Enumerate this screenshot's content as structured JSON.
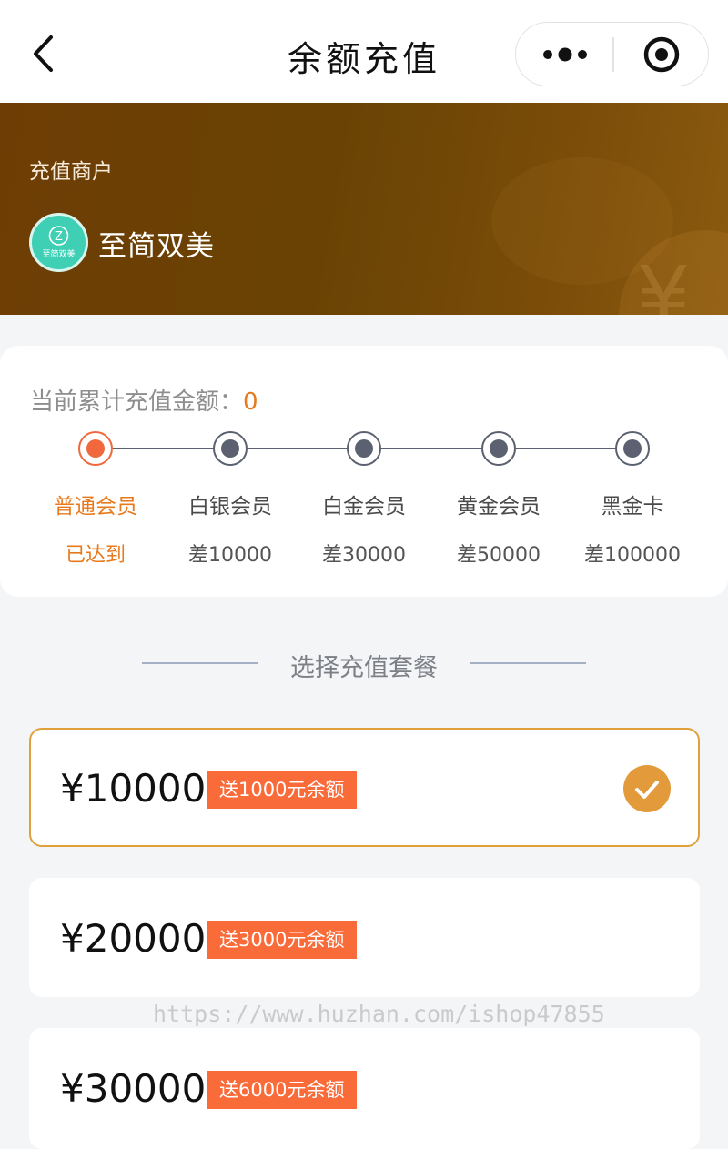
{
  "navbar": {
    "title": "余额充值",
    "back_icon": "chevron-left-icon",
    "more_icon": "more-dots-icon",
    "close_icon": "target-circle-icon"
  },
  "merchant": {
    "label": "充值商户",
    "name": "至简双美",
    "logo_icon": "merchant-logo-icon",
    "logo_text": "至简双美",
    "logo_letter": "Z",
    "banner_symbol": "¥"
  },
  "membership": {
    "cumulative_label": "当前累计充值金额：",
    "cumulative_value": "0",
    "levels": [
      {
        "name": "普通会员",
        "status": "已达到",
        "reached": true
      },
      {
        "name": "白银会员",
        "status": "差10000",
        "reached": false
      },
      {
        "name": "白金会员",
        "status": "差30000",
        "reached": false
      },
      {
        "name": "黄金会员",
        "status": "差50000",
        "reached": false
      },
      {
        "name": "黑金卡",
        "status": "差100000",
        "reached": false
      }
    ]
  },
  "plans_section": {
    "title": "选择充值套餐"
  },
  "plans": [
    {
      "price": "¥10000",
      "bonus": "送1000元余额",
      "selected": true
    },
    {
      "price": "¥20000",
      "bonus": "送3000元余额",
      "selected": false
    },
    {
      "price": "¥30000",
      "bonus": "送6000元余额",
      "selected": false
    }
  ],
  "watermark": "https://www.huzhan.com/ishop47855",
  "colors": {
    "accent_orange": "#e87a1e",
    "tag_orange": "#fa6b3a",
    "check_gold": "#e29a3a",
    "banner_brown": "#6e3d05",
    "active_node": "#f0683c"
  }
}
